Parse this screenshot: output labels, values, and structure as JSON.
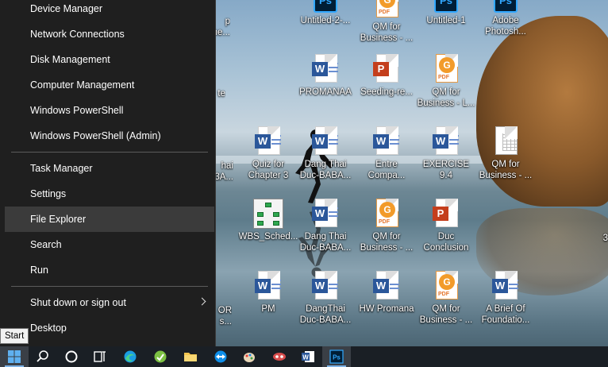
{
  "start_menu": {
    "items": [
      {
        "label": "Device Manager"
      },
      {
        "label": "Network Connections"
      },
      {
        "label": "Disk Management"
      },
      {
        "label": "Computer Management"
      },
      {
        "label": "Windows PowerShell"
      },
      {
        "label": "Windows PowerShell (Admin)"
      },
      {
        "label": "Task Manager"
      },
      {
        "label": "Settings"
      },
      {
        "label": "File Explorer"
      },
      {
        "label": "Search"
      },
      {
        "label": "Run"
      },
      {
        "label": "Shut down or sign out"
      },
      {
        "label": "Desktop"
      }
    ],
    "hovered": "File Explorer"
  },
  "tooltip": {
    "text": "Start"
  },
  "desktop": {
    "icons": [
      {
        "label": "Untitled-2-...",
        "type": "photoshop-icon"
      },
      {
        "label": "QM for Business - ...",
        "type": "pdf-icon"
      },
      {
        "label": "Untitled-1",
        "type": "photoshop-icon"
      },
      {
        "label": "Adobe Photosh...",
        "type": "photoshop-shortcut-icon"
      },
      {
        "label": "PROMANAA",
        "type": "word-icon"
      },
      {
        "label": "Seeding-re...",
        "type": "powerpoint-icon"
      },
      {
        "label": "QM for Business - L...",
        "type": "pdf-icon"
      },
      {
        "label": "Quiz for Chapter 3",
        "type": "word-icon"
      },
      {
        "label": "Dang Thai Duc-BABA...",
        "type": "word-icon"
      },
      {
        "label": "Entre Compa...",
        "type": "word-icon"
      },
      {
        "label": "EXERCISE 9.4",
        "type": "word-icon"
      },
      {
        "label": "QM for Business - ...",
        "type": "spreadsheet-icon"
      },
      {
        "label": "WBS_Sched...",
        "type": "wbs-diagram-icon"
      },
      {
        "label": "Dang Thai Duc-BABA...",
        "type": "word-icon"
      },
      {
        "label": "QM for Business - ...",
        "type": "pdf-icon"
      },
      {
        "label": "Duc Conclusion",
        "type": "powerpoint-icon"
      },
      {
        "label": "PM",
        "type": "word-icon"
      },
      {
        "label": "DangThai Duc-BABA...",
        "type": "word-icon"
      },
      {
        "label": "HW Promana",
        "type": "word-icon"
      },
      {
        "label": "QM for Business - ...",
        "type": "pdf-icon"
      },
      {
        "label": "A Brief Of Foundatio...",
        "type": "word-icon"
      }
    ],
    "partial_labels": [
      {
        "text": "p"
      },
      {
        "text": "ne..."
      },
      {
        "text": "te"
      },
      {
        "text": "hai"
      },
      {
        "text": "3A..."
      },
      {
        "text": "OR"
      },
      {
        "text": "s..."
      },
      {
        "text": "3"
      }
    ]
  },
  "taskbar": {
    "buttons": [
      {
        "name": "start-button",
        "icon": "windows-logo-icon"
      },
      {
        "name": "search-button",
        "icon": "search-icon"
      },
      {
        "name": "cortana-button",
        "icon": "cortana-circle-icon"
      },
      {
        "name": "task-view-button",
        "icon": "task-view-icon"
      },
      {
        "name": "edge-button",
        "icon": "edge-icon"
      },
      {
        "name": "app-green-button",
        "icon": "green-app-icon"
      },
      {
        "name": "file-explorer-button",
        "icon": "folder-icon"
      },
      {
        "name": "teamviewer-button",
        "icon": "teamviewer-icon"
      },
      {
        "name": "app-paint-button",
        "icon": "paint-icon"
      },
      {
        "name": "app-game-button",
        "icon": "game-icon"
      },
      {
        "name": "word-button",
        "icon": "word-icon"
      },
      {
        "name": "photoshop-button",
        "icon": "photoshop-icon"
      }
    ]
  },
  "colors": {
    "menu_bg": "#1f1f1f",
    "menu_hover": "#3b3b3b",
    "taskbar_bg": "#1a1f25",
    "word_blue": "#2b579a",
    "ppt_red": "#c43e1c",
    "pdf_orange": "#f29b2a"
  }
}
